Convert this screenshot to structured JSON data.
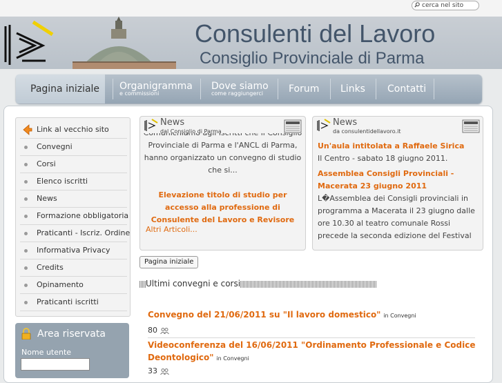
{
  "search": {
    "placeholder": "cerca nel sito"
  },
  "header": {
    "title": "Consulenti del Lavoro",
    "subtitle": "Consiglio Provinciale di Parma"
  },
  "nav": [
    {
      "label": "Pagina iniziale",
      "sub": ""
    },
    {
      "label": "Organigramma",
      "sub": "e commissioni"
    },
    {
      "label": "Dove siamo",
      "sub": "come raggiungerci"
    },
    {
      "label": "Forum",
      "sub": ""
    },
    {
      "label": "Links",
      "sub": ""
    },
    {
      "label": "Contatti",
      "sub": ""
    }
  ],
  "sidebar": {
    "old_site_link": "Link al vecchio sito",
    "items": [
      "Convegni",
      "Corsi",
      "Elenco iscritti",
      "News",
      "Formazione obbligatoria",
      "Praticanti - Iscriz. Ordine",
      "Informativa Privacy",
      "Credits",
      "Opinamento",
      "Praticanti iscritti"
    ]
  },
  "reserved": {
    "title": "Area riservata",
    "user_label": "Nome utente"
  },
  "news_left": {
    "title": "News",
    "subtitle": "dal Consiglio di Parma",
    "text": "Comunichiamo agli iscritti che il Consiglio Provinciale di Parma e l'ANCL di Parma, hanno organizzato un convegno di studio che si...",
    "link": "Elevazione titolo di studio per accesso alla professione di Consulente del Lavoro e Revisore",
    "more": "Altri Articoli..."
  },
  "news_right": {
    "title": "News",
    "subtitle": "da consulentidellavoro.it",
    "link1": "Un'aula intitolata a Raffaele Sirica",
    "text1": "Il Centro - sabato 18 giugno 2011.",
    "link2": "Assemblea Consigli Provinciali - Macerata 23 giugno 2011",
    "text2": "L�Assemblea dei Consigli provinciali in programma a Macerata il 23 giugno dalle ore 10.30 al teatro comunale Rossi precede la seconda edizione del Festival"
  },
  "home_button": "Pagina iniziale",
  "section_title": "Ultimi convegni e corsi",
  "convegni": [
    {
      "title": "Convegno del 21/06/2011 su \"Il lavoro domestico\"",
      "in": "in Convegni",
      "count": "80"
    },
    {
      "title_line1": "Videoconferenza del 16/06/2011 \"Ordinamento Professionale e Codice",
      "title_line2": "Deontologico\"",
      "in": "in Convegni",
      "count": "33"
    }
  ],
  "colors": {
    "accent": "#e06a10",
    "nav": "#95a5b4",
    "header_text": "#43556a"
  }
}
